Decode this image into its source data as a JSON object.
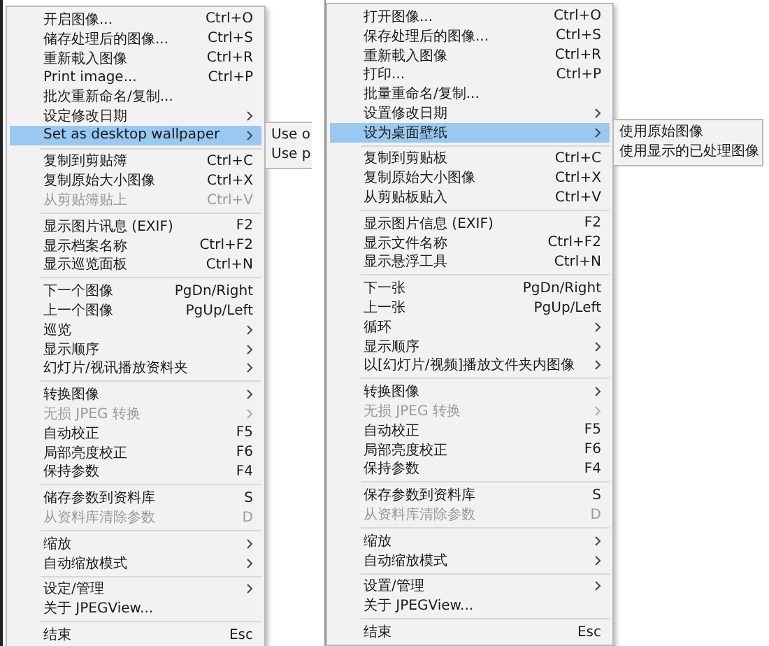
{
  "menus": [
    {
      "items": [
        {
          "kind": "item",
          "label": "开启图像...",
          "shortcut": "Ctrl+O",
          "selected": false
        },
        {
          "kind": "item",
          "label": "储存处理后的图像...",
          "shortcut": "Ctrl+S",
          "selected": false
        },
        {
          "kind": "item",
          "label": "重新載入图像",
          "shortcut": "Ctrl+R",
          "selected": false
        },
        {
          "kind": "item",
          "label": "Print image...",
          "shortcut": "Ctrl+P",
          "selected": false
        },
        {
          "kind": "item",
          "label": "批次重新命名/复制...",
          "selected": false
        },
        {
          "kind": "item",
          "label": "设定修改日期",
          "has_submenu": true,
          "selected": false
        },
        {
          "kind": "item",
          "label": "Set as desktop wallpaper",
          "has_submenu": true,
          "selected": true,
          "submenu": [
            "Use o",
            "Use p"
          ]
        },
        {
          "kind": "separator"
        },
        {
          "kind": "item",
          "label": "复制到剪贴簿",
          "shortcut": "Ctrl+C",
          "selected": false
        },
        {
          "kind": "item",
          "label": "复制原始大小图像",
          "shortcut": "Ctrl+X",
          "selected": false
        },
        {
          "kind": "item",
          "label": "从剪贴簿贴上",
          "shortcut": "Ctrl+V",
          "disabled": true,
          "selected": false
        },
        {
          "kind": "separator"
        },
        {
          "kind": "item",
          "label": "显示图片讯息 (EXIF)",
          "shortcut": "F2",
          "selected": false
        },
        {
          "kind": "item",
          "label": "显示档案名称",
          "shortcut": "Ctrl+F2",
          "selected": false
        },
        {
          "kind": "item",
          "label": "显示巡览面板",
          "shortcut": "Ctrl+N",
          "selected": false
        },
        {
          "kind": "separator"
        },
        {
          "kind": "item",
          "label": "下一个图像",
          "shortcut": "PgDn/Right",
          "selected": false
        },
        {
          "kind": "item",
          "label": "上一个图像",
          "shortcut": "PgUp/Left",
          "selected": false
        },
        {
          "kind": "item",
          "label": "巡览",
          "has_submenu": true,
          "selected": false
        },
        {
          "kind": "item",
          "label": "显示顺序",
          "has_submenu": true,
          "selected": false
        },
        {
          "kind": "item",
          "label": "幻灯片/视讯播放资料夹",
          "has_submenu": true,
          "selected": false
        },
        {
          "kind": "separator"
        },
        {
          "kind": "item",
          "label": "转换图像",
          "has_submenu": true,
          "selected": false
        },
        {
          "kind": "item",
          "label": "无损 JPEG 转换",
          "has_submenu": true,
          "disabled": true,
          "selected": false
        },
        {
          "kind": "item",
          "label": "自动校正",
          "shortcut": "F5",
          "selected": false
        },
        {
          "kind": "item",
          "label": "局部亮度校正",
          "shortcut": "F6",
          "selected": false
        },
        {
          "kind": "item",
          "label": "保持参数",
          "shortcut": "F4",
          "selected": false
        },
        {
          "kind": "separator"
        },
        {
          "kind": "item",
          "label": "储存参数到资料库",
          "shortcut": "S",
          "selected": false
        },
        {
          "kind": "item",
          "label": "从资料库清除参数",
          "shortcut": "D",
          "disabled": true,
          "selected": false
        },
        {
          "kind": "separator"
        },
        {
          "kind": "item",
          "label": "缩放",
          "has_submenu": true,
          "selected": false
        },
        {
          "kind": "item",
          "label": "自动缩放模式",
          "has_submenu": true,
          "selected": false
        },
        {
          "kind": "separator"
        },
        {
          "kind": "item",
          "label": "设定/管理",
          "has_submenu": true,
          "selected": false
        },
        {
          "kind": "item",
          "label": "关于 JPEGView...",
          "selected": false
        },
        {
          "kind": "separator"
        },
        {
          "kind": "item",
          "label": "结束",
          "shortcut": "Esc",
          "selected": false
        }
      ]
    },
    {
      "items": [
        {
          "kind": "item",
          "label": "打开图像...",
          "shortcut": "Ctrl+O",
          "selected": false
        },
        {
          "kind": "item",
          "label": "保存处理后的图像...",
          "shortcut": "Ctrl+S",
          "selected": false
        },
        {
          "kind": "item",
          "label": "重新載入图像",
          "shortcut": "Ctrl+R",
          "selected": false
        },
        {
          "kind": "item",
          "label": "打印...",
          "shortcut": "Ctrl+P",
          "selected": false
        },
        {
          "kind": "item",
          "label": "批量重命名/复制...",
          "selected": false
        },
        {
          "kind": "item",
          "label": "设置修改日期",
          "has_submenu": true,
          "selected": false
        },
        {
          "kind": "item",
          "label": "设为桌面壁纸",
          "has_submenu": true,
          "selected": true,
          "submenu": [
            "使用原始图像",
            "使用显示的已处理图像"
          ]
        },
        {
          "kind": "separator"
        },
        {
          "kind": "item",
          "label": "复制到剪贴板",
          "shortcut": "Ctrl+C",
          "selected": false
        },
        {
          "kind": "item",
          "label": "复制原始大小图像",
          "shortcut": "Ctrl+X",
          "selected": false
        },
        {
          "kind": "item",
          "label": "从剪贴板贴入",
          "shortcut": "Ctrl+V",
          "selected": false
        },
        {
          "kind": "separator"
        },
        {
          "kind": "item",
          "label": "显示图片信息 (EXIF)",
          "shortcut": "F2",
          "selected": false
        },
        {
          "kind": "item",
          "label": "显示文件名称",
          "shortcut": "Ctrl+F2",
          "selected": false
        },
        {
          "kind": "item",
          "label": "显示悬浮工具",
          "shortcut": "Ctrl+N",
          "selected": false
        },
        {
          "kind": "separator"
        },
        {
          "kind": "item",
          "label": "下一张",
          "shortcut": "PgDn/Right",
          "selected": false
        },
        {
          "kind": "item",
          "label": "上一张",
          "shortcut": "PgUp/Left",
          "selected": false
        },
        {
          "kind": "item",
          "label": "循环",
          "has_submenu": true,
          "selected": false
        },
        {
          "kind": "item",
          "label": "显示顺序",
          "has_submenu": true,
          "selected": false
        },
        {
          "kind": "item",
          "label": "以[幻灯片/视频]播放文件夹内图像",
          "has_submenu": true,
          "selected": false
        },
        {
          "kind": "separator"
        },
        {
          "kind": "item",
          "label": "转换图像",
          "has_submenu": true,
          "selected": false
        },
        {
          "kind": "item",
          "label": "无损 JPEG 转换",
          "has_submenu": true,
          "disabled": true,
          "selected": false
        },
        {
          "kind": "item",
          "label": "自动校正",
          "shortcut": "F5",
          "selected": false
        },
        {
          "kind": "item",
          "label": "局部亮度校正",
          "shortcut": "F6",
          "selected": false
        },
        {
          "kind": "item",
          "label": "保持参数",
          "shortcut": "F4",
          "selected": false
        },
        {
          "kind": "separator"
        },
        {
          "kind": "item",
          "label": "保存参数到资料库",
          "shortcut": "S",
          "selected": false
        },
        {
          "kind": "item",
          "label": "从资料库清除参数",
          "shortcut": "D",
          "disabled": true,
          "selected": false
        },
        {
          "kind": "separator"
        },
        {
          "kind": "item",
          "label": "缩放",
          "has_submenu": true,
          "selected": false
        },
        {
          "kind": "item",
          "label": "自动缩放模式",
          "has_submenu": true,
          "selected": false
        },
        {
          "kind": "separator"
        },
        {
          "kind": "item",
          "label": "设置/管理",
          "has_submenu": true,
          "selected": false
        },
        {
          "kind": "item",
          "label": "关于 JPEGView...",
          "selected": false
        },
        {
          "kind": "separator"
        },
        {
          "kind": "item",
          "label": "结束",
          "shortcut": "Esc",
          "selected": false
        }
      ]
    }
  ]
}
